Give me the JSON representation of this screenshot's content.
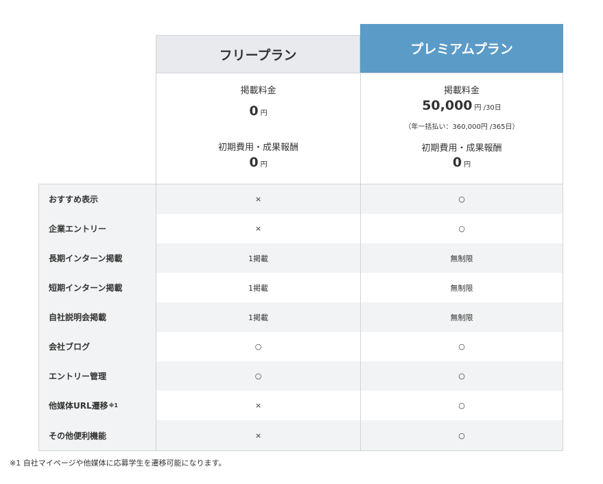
{
  "plans": {
    "free": {
      "name": "フリープラン",
      "listing_fee_label": "掲載料金",
      "listing_fee_value": "0",
      "listing_fee_unit": "円",
      "initial_label": "初期費用・成果報酬",
      "initial_value": "0",
      "initial_unit": "円"
    },
    "premium": {
      "name": "プレミアムプラン",
      "listing_fee_label": "掲載料金",
      "listing_fee_value": "50,000",
      "listing_fee_unit": "円 /30日",
      "listing_fee_note": "（年一括払い：360,000円 /365日）",
      "initial_label": "初期費用・成果報酬",
      "initial_value": "0",
      "initial_unit": "円"
    }
  },
  "features": [
    {
      "name": "おすすめ表示",
      "free": "×",
      "premium": "○"
    },
    {
      "name": "企業エントリー",
      "free": "×",
      "premium": "○"
    },
    {
      "name": "長期インターン掲載",
      "free": "1掲載",
      "premium": "無制限"
    },
    {
      "name": "短期インターン掲載",
      "free": "1掲載",
      "premium": "無制限"
    },
    {
      "name": "自社説明会掲載",
      "free": "1掲載",
      "premium": "無制限"
    },
    {
      "name": "会社ブログ",
      "free": "○",
      "premium": "○"
    },
    {
      "name": "エントリー管理",
      "free": "○",
      "premium": "○"
    },
    {
      "name": "他媒体URL遷移",
      "note_mark": "※1",
      "free": "×",
      "premium": "○"
    },
    {
      "name": "その他便利機能",
      "free": "×",
      "premium": "○"
    }
  ],
  "footnote": "※1 自社マイページや他媒体に応募学生を遷移可能になります。",
  "colors": {
    "premium_header": "#5b9bc8",
    "free_header": "#e8eaee",
    "row_alt": "#f2f3f4",
    "border": "#cfd3d8"
  }
}
